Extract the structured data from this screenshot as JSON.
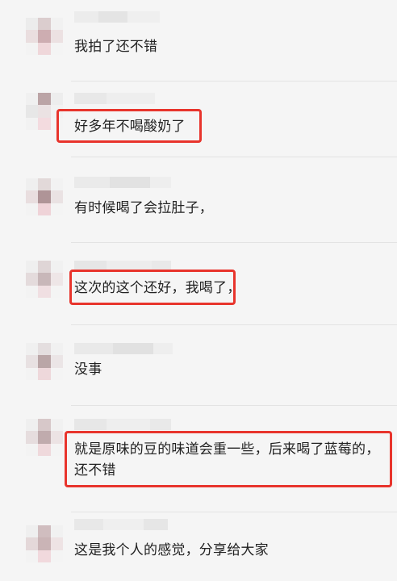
{
  "comments": [
    {
      "text": "我拍了还不错",
      "highlighted": false
    },
    {
      "text": "好多年不喝酸奶了",
      "highlighted": true
    },
    {
      "text": "有时候喝了会拉肚子，",
      "highlighted": false
    },
    {
      "text": "这次的这个还好，我喝了，",
      "highlighted": true
    },
    {
      "text": "没事",
      "highlighted": false
    },
    {
      "text": "就是原味的豆的味道会重一些，后来喝了蓝莓的，还不错",
      "highlighted": true
    },
    {
      "text": "这是我个人的感觉，分享给大家",
      "highlighted": false
    }
  ],
  "colors": {
    "highlight_border": "#e8342c",
    "background": "#f5f5f5",
    "text": "#222222"
  }
}
